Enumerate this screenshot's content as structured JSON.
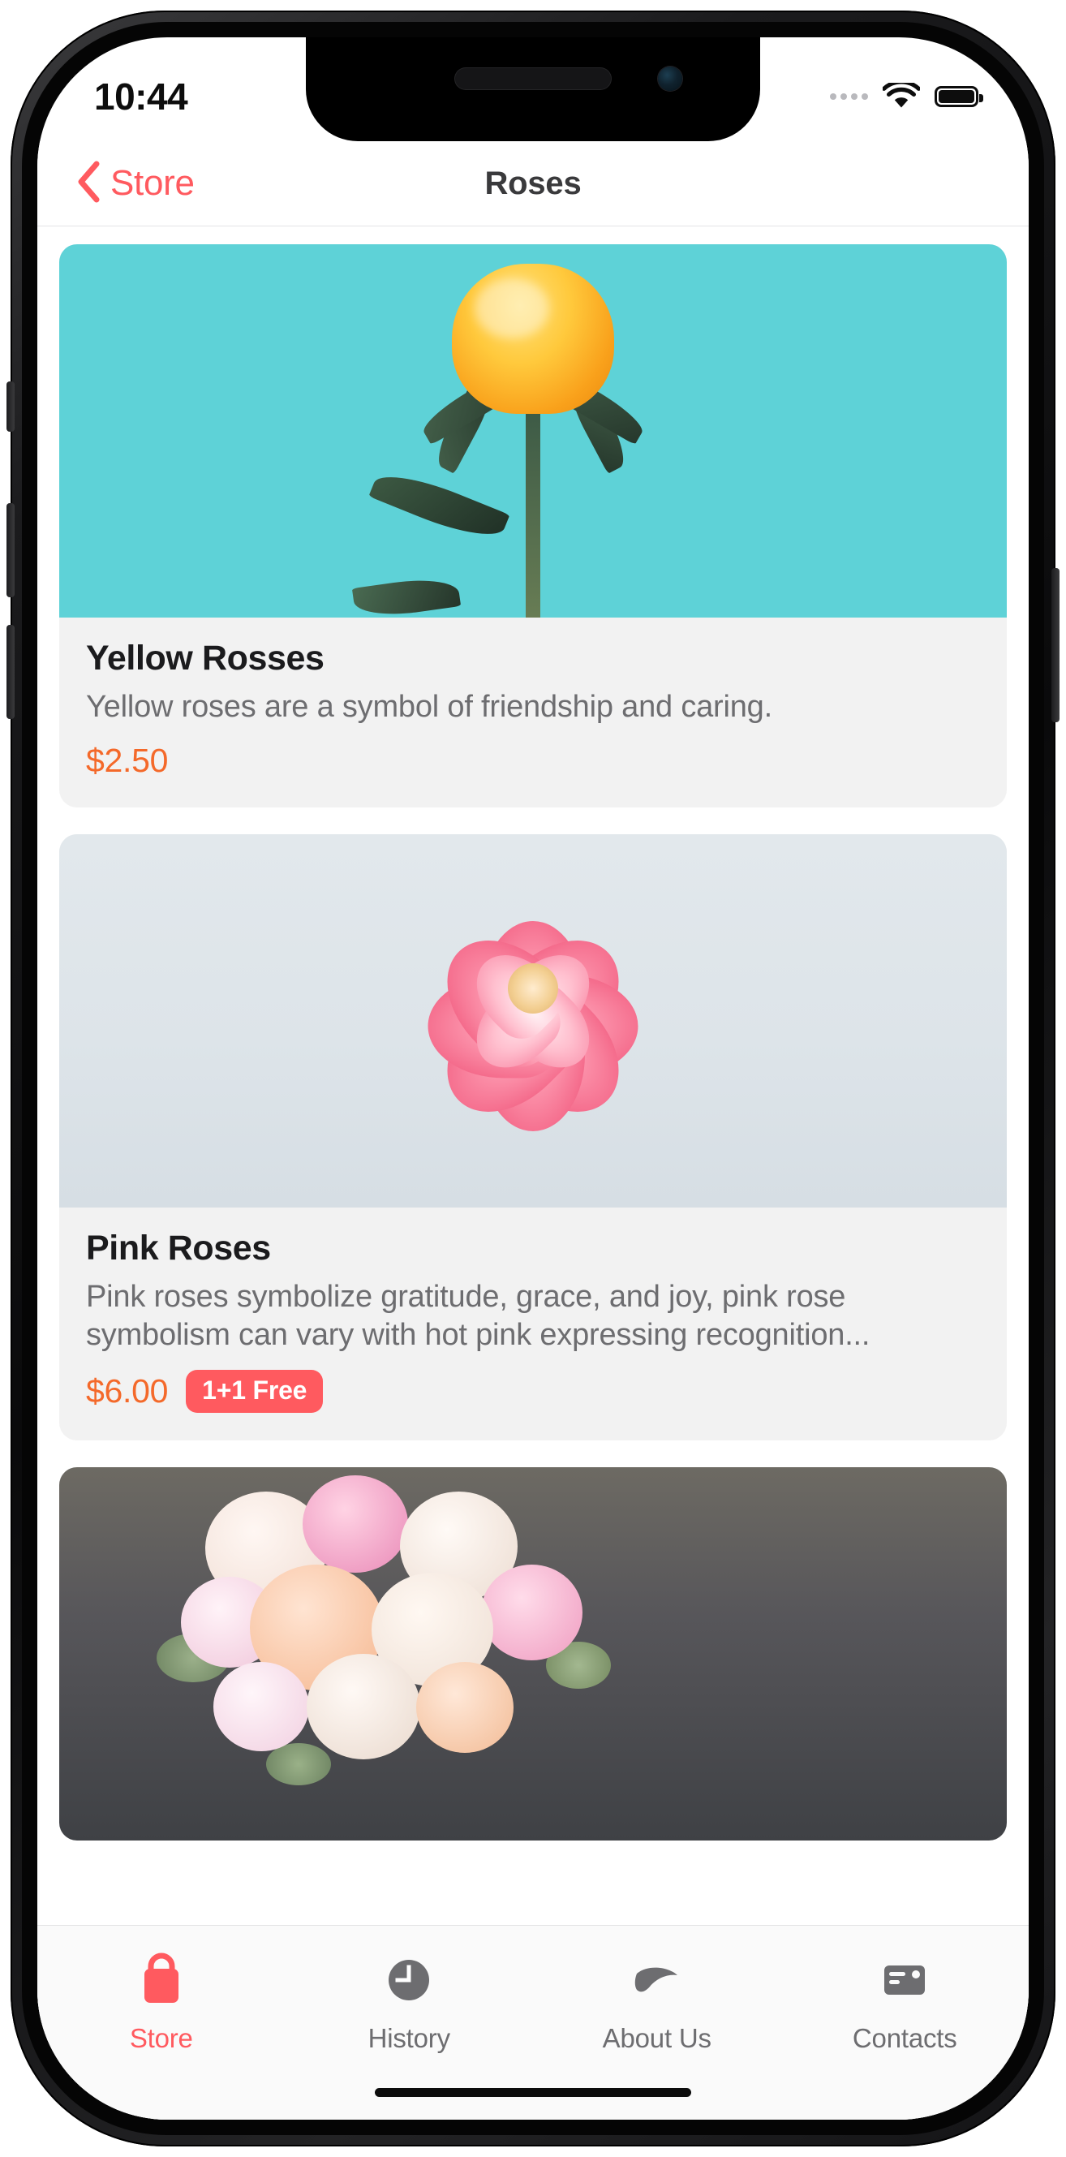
{
  "status_bar": {
    "time": "10:44",
    "cellular_icon": "cellular-dots-icon",
    "wifi_icon": "wifi-icon",
    "battery_icon": "battery-full-icon"
  },
  "nav_bar": {
    "back_icon": "chevron-left-icon",
    "back_label": "Store",
    "title": "Roses"
  },
  "colors": {
    "accent_red": "#ff5a5f",
    "price_orange": "#f4692a",
    "card_bg": "#f2f2f2",
    "title_gray": "#3a3a3c",
    "body_gray": "#6d6d70"
  },
  "products": [
    {
      "title": "Yellow Rosses",
      "description": "Yellow roses are a symbol of friendship and caring.",
      "price": "$2.50",
      "badge": "",
      "photo": "yellow-rose-on-turquoise"
    },
    {
      "title": "Pink Roses",
      "description": "Pink roses symbolize gratitude, grace, and joy, pink rose symbolism can vary with hot pink expressing recognition...",
      "price": "$6.00",
      "badge": "1+1 Free",
      "photo": "pink-rose-on-grey"
    },
    {
      "title": "",
      "description": "",
      "price": "",
      "badge": "",
      "photo": "mixed-rose-bouquet"
    }
  ],
  "tab_bar": {
    "items": [
      {
        "label": "Store",
        "icon": "shopping-bag-icon",
        "active": true
      },
      {
        "label": "History",
        "icon": "clock-icon",
        "active": false
      },
      {
        "label": "About Us",
        "icon": "leaf-icon",
        "active": false
      },
      {
        "label": "Contacts",
        "icon": "contact-card-icon",
        "active": false
      }
    ]
  }
}
